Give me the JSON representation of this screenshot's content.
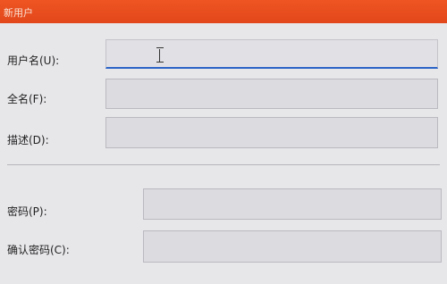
{
  "window": {
    "title": "新用户"
  },
  "form": {
    "username_label": "用户名(U):",
    "username_value": "",
    "fullname_label": "全名(F):",
    "fullname_value": "",
    "description_label": "描述(D):",
    "description_value": "",
    "password_label": "密码(P):",
    "password_value": "",
    "confirm_password_label": "确认密码(C):",
    "confirm_password_value": ""
  },
  "colors": {
    "titlebar": "#e2471b",
    "focus_underline": "#2c64c7"
  }
}
